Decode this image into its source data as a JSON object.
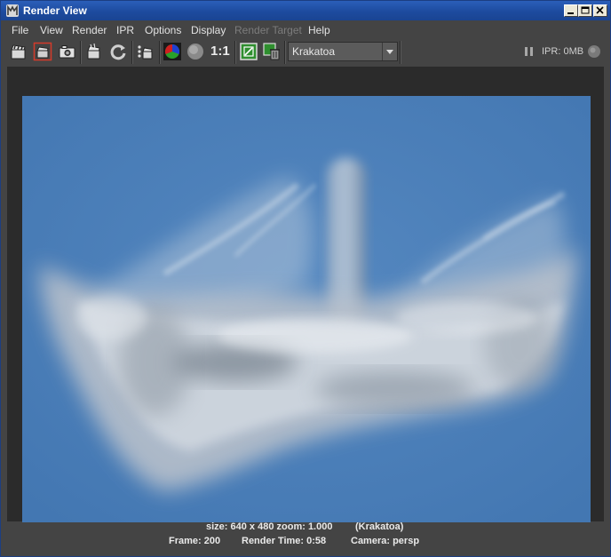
{
  "window": {
    "title": "Render View"
  },
  "menu": [
    "File",
    "View",
    "Render",
    "IPR",
    "Options",
    "Display",
    "Render Target",
    "Help"
  ],
  "menu_disabled": [
    "Render Target"
  ],
  "toolbar": {
    "icons": [
      "clapper-icon",
      "region-clapper-icon",
      "snapshot-camera-icon",
      "ipr-clapper-icon",
      "refresh-icon",
      "render-sequence-icon",
      "color-channels-icon",
      "alpha-channel-icon",
      "keep-image-icon",
      "remove-image-icon"
    ],
    "ratio_label": "1:1",
    "renderer_select": "Krakatoa",
    "ipr_status": "IPR: 0MB"
  },
  "status": {
    "size": "size: 640 x 480 zoom: 1.000",
    "renderer": "(Krakatoa)",
    "frame": "Frame: 200",
    "render_time": "Render Time: 0:58",
    "camera": "Camera: persp"
  },
  "colors": {
    "title_bar": "#1d4b9f",
    "ui_background": "#444444",
    "render_background": "#4a7eb7"
  }
}
